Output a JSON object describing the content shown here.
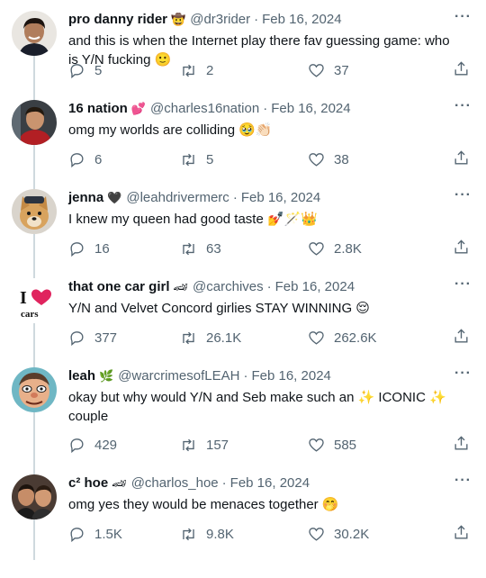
{
  "tweets": [
    {
      "display_name": "pro danny rider",
      "name_emoji": "🤠",
      "handle": "@dr3rider",
      "separator": "·",
      "date": "Feb 16, 2024",
      "text": "and this is when the Internet play there fav guessing game: who is Y/N fucking 🙂",
      "replies": "5",
      "retweets": "2",
      "likes": "37",
      "avatar": "avatar-man-dark-hair"
    },
    {
      "display_name": "16 nation",
      "name_emoji": "💕",
      "handle": "@charles16nation",
      "separator": "·",
      "date": "Feb 16, 2024",
      "text": "omg my worlds are colliding 🥹👏🏻",
      "replies": "6",
      "retweets": "5",
      "likes": "38",
      "avatar": "avatar-man-red-jacket"
    },
    {
      "display_name": "jenna",
      "name_emoji": "🖤",
      "handle": "@leahdrivermerc",
      "separator": "·",
      "date": "Feb 16, 2024",
      "text": "I knew my queen had good taste 💅🪄👑",
      "replies": "16",
      "retweets": "63",
      "likes": "2.8K",
      "avatar": "avatar-dog"
    },
    {
      "display_name": "that one car girl",
      "name_emoji": "🏎",
      "handle": "@carchives",
      "separator": "·",
      "date": "Feb 16, 2024",
      "text": "Y/N and Velvet Concord girlies STAY WINNING 😌",
      "replies": "377",
      "retweets": "26.1K",
      "likes": "262.6K",
      "avatar": "avatar-i-love-cars",
      "avatar_text_top": "I",
      "avatar_text_bottom": "cars"
    },
    {
      "display_name": "leah",
      "name_emoji": "🌿",
      "handle": "@warcrimesofLEAH",
      "separator": "·",
      "date": "Feb 16, 2024",
      "text": "okay but why would Y/N and Seb make such an ✨ ICONIC ✨ couple",
      "replies": "429",
      "retweets": "157",
      "likes": "585",
      "avatar": "avatar-cartoon-face"
    },
    {
      "display_name": "c² hoe",
      "name_emoji": "🏎",
      "handle": "@charlos_hoe",
      "separator": "·",
      "date": "Feb 16, 2024",
      "text": "omg yes they would be menaces together 🤭",
      "replies": "1.5K",
      "retweets": "9.8K",
      "likes": "30.2K",
      "avatar": "avatar-two-men"
    }
  ],
  "more_label": "···",
  "icons": {
    "reply": "reply-icon",
    "retweet": "retweet-icon",
    "like": "heart-icon",
    "share": "share-icon"
  },
  "colors": {
    "text": "#0f1419",
    "secondary": "#536471",
    "thread_line": "#cfd9de",
    "heart_red": "#e0245e"
  }
}
